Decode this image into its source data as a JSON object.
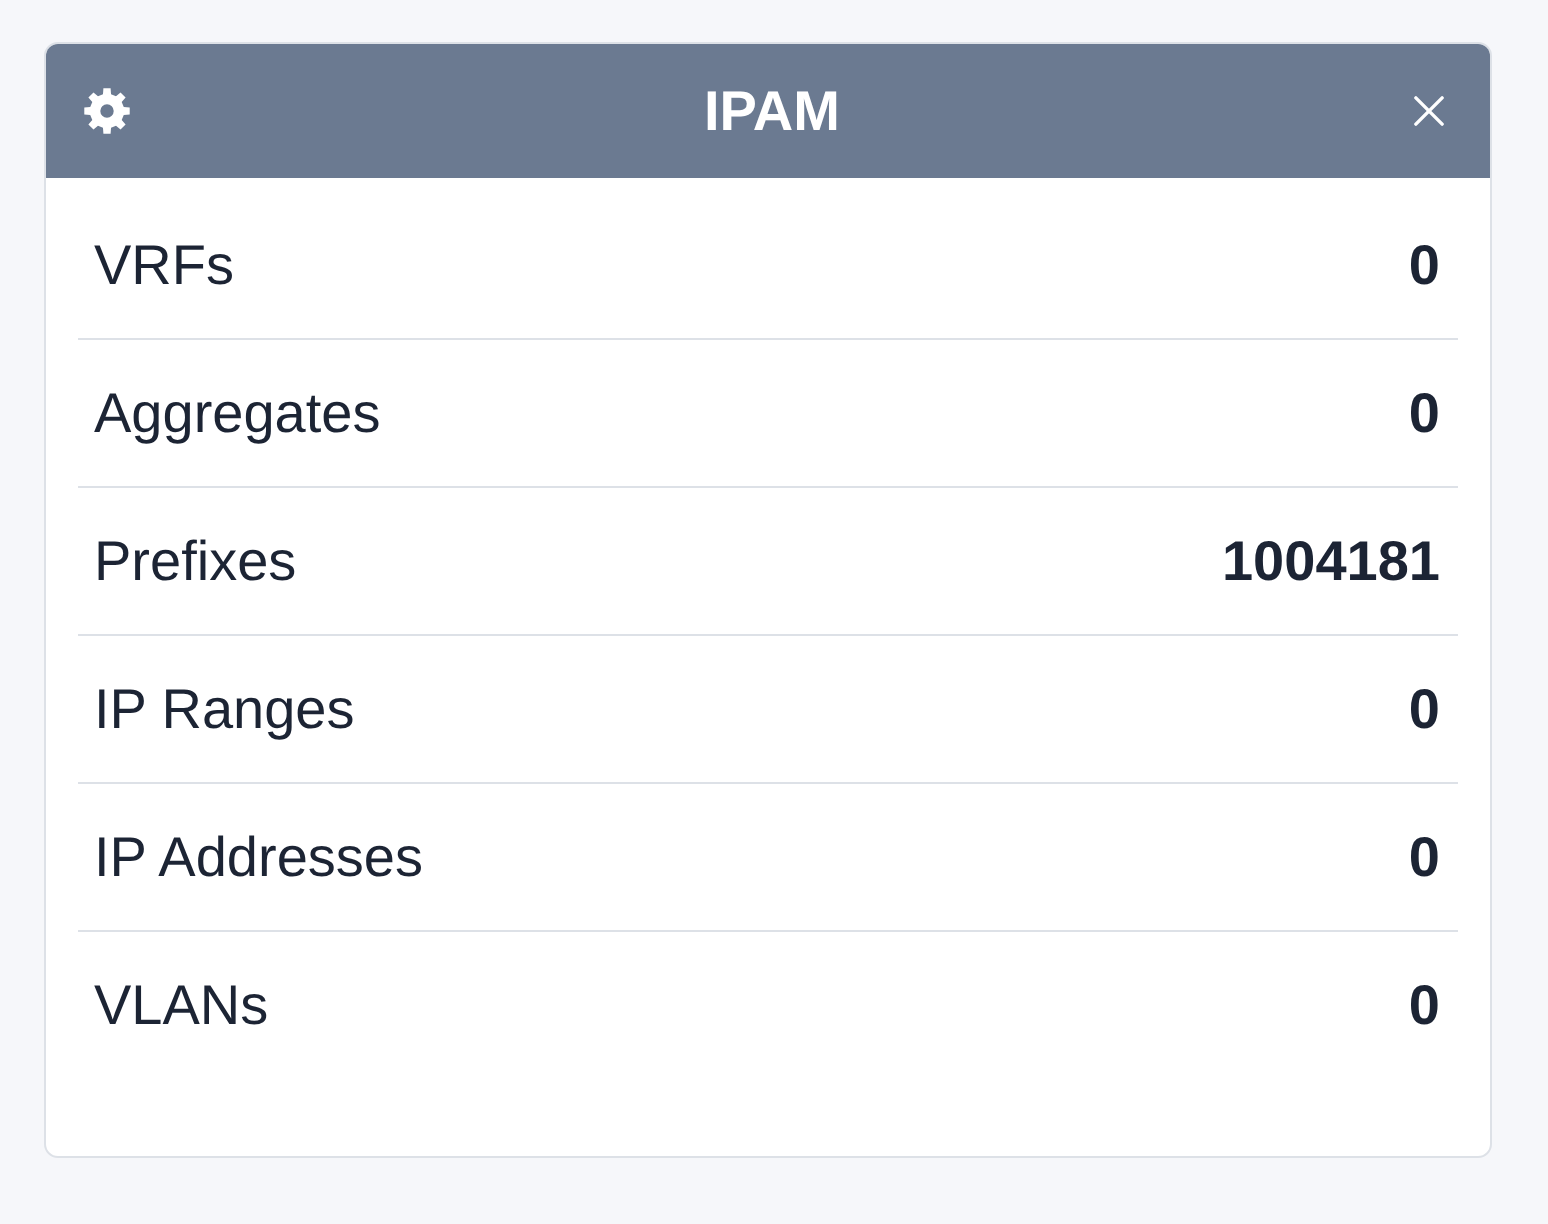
{
  "widget": {
    "title": "IPAM",
    "rows": [
      {
        "label": "VRFs",
        "count": "0"
      },
      {
        "label": "Aggregates",
        "count": "0"
      },
      {
        "label": "Prefixes",
        "count": "1004181"
      },
      {
        "label": "IP Ranges",
        "count": "0"
      },
      {
        "label": "IP Addresses",
        "count": "0"
      },
      {
        "label": "VLANs",
        "count": "0"
      }
    ]
  }
}
